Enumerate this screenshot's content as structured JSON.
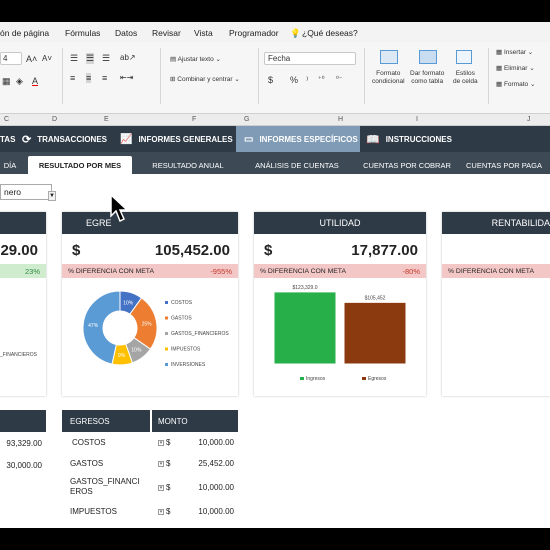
{
  "ribbon": {
    "menu": [
      "ón de página",
      "Fórmulas",
      "Datos",
      "Revisar",
      "Vista",
      "Programador",
      "¿Qué deseas?"
    ],
    "font_size": "4",
    "wrap_text": "Ajustar texto",
    "merge_center": "Combinar y centrar",
    "number_format": "Fecha",
    "currency_symbol": "$",
    "percent_symbol": "%",
    "conditional_format": [
      "Formato",
      "condicional"
    ],
    "table_format": [
      "Dar formato",
      "como tabla"
    ],
    "cell_styles": [
      "Estilos",
      "de celda"
    ],
    "insert": "Insertar",
    "delete": "Eliminar",
    "format": "Formato"
  },
  "columns": [
    "C",
    "D",
    "E",
    "F",
    "G",
    "H",
    "I",
    "J"
  ],
  "nav": {
    "items": [
      "TAS",
      "TRANSACCIONES",
      "INFORMES GENERALES",
      "INFORMES ESPECÍFICOS",
      "INSTRUCCIONES"
    ],
    "active": 3
  },
  "subnav": {
    "items": [
      "DÍA",
      "RESULTADO POR MES",
      "RESULTADO ANUAL",
      "ANÁLISIS DE CUENTAS",
      "CUENTAS POR COBRAR",
      "CUENTAS POR PAGA"
    ],
    "active": 1
  },
  "month": "nero",
  "cards": {
    "ingresos": {
      "amount": "29.00",
      "pct": "23%"
    },
    "egresos": {
      "title": "EGRE",
      "currency": "$",
      "amount": "105,452.00",
      "diff_label": "% DIFERENCIA CON META",
      "pct": "-955%"
    },
    "utilidad": {
      "title": "UTILIDAD",
      "currency": "$",
      "amount": "17,877.00",
      "diff_label": "% DIFERENCIA CON META",
      "pct": "-80%"
    },
    "rentabilidad": {
      "title": "RENTABILIDA",
      "diff_label": "% DIFERENCIA CON META"
    }
  },
  "left_fragment": {
    "legend_label": "_FINANCIEROS"
  },
  "chart_data": [
    {
      "type": "pie",
      "title": "",
      "labels": [
        "COSTOS",
        "GASTOS",
        "GASTOS_FINANCIEROS",
        "IMPUESTOS",
        "INVERSIONES"
      ],
      "values": [
        10,
        25,
        10,
        9,
        47
      ],
      "data_labels": [
        "10%",
        "25%",
        "10%",
        "9%",
        "47%"
      ],
      "colors": [
        "#4472c4",
        "#ed7d31",
        "#a5a5a5",
        "#ffc000",
        "#5b9bd5"
      ]
    },
    {
      "type": "bar",
      "title": "",
      "categories": [
        "Ingresos",
        "Egresos"
      ],
      "values": [
        123329,
        105452
      ],
      "data_labels": [
        "$123,329.0",
        "$105,452"
      ],
      "colors": [
        "#27b04a",
        "#8b3a0f"
      ],
      "ylim": [
        0,
        130000
      ],
      "legend": [
        "Ingresos",
        "Egresos"
      ]
    }
  ],
  "egresos_table": {
    "headers": [
      "EGRESOS",
      "MONTO"
    ],
    "rows": [
      {
        "name": "COSTOS",
        "cur": "$",
        "amount": "10,000.00"
      },
      {
        "name": "GASTOS",
        "cur": "$",
        "amount": "25,452.00"
      },
      {
        "name": "GASTOS_FINANCI",
        "name2": "EROS",
        "cur": "$",
        "amount": "10,000.00"
      },
      {
        "name": "IMPUESTOS",
        "cur": "$",
        "amount": "10,000.00"
      }
    ]
  },
  "ingresos_table": {
    "rows": [
      "93,329.00",
      "30,000.00"
    ]
  }
}
